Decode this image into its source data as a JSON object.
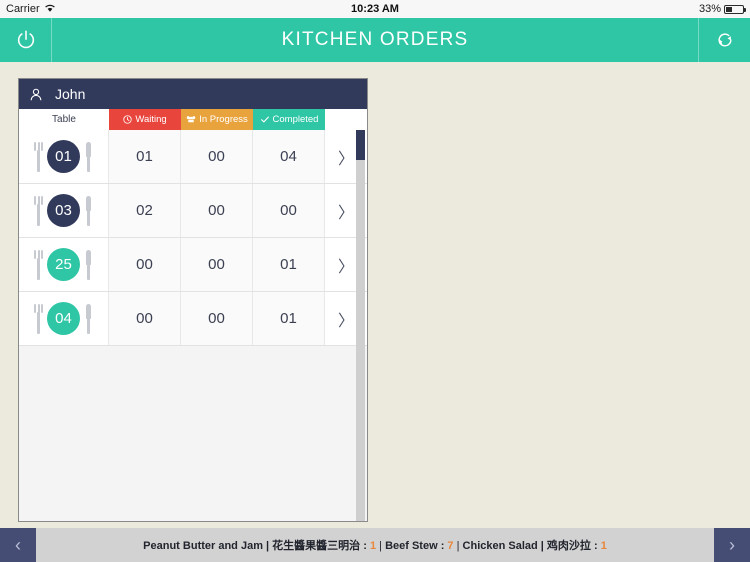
{
  "status_bar": {
    "carrier": "Carrier",
    "wifi_icon": "wifi-icon",
    "time": "10:23 AM",
    "battery_percent": "33%",
    "battery_level": 33
  },
  "app_header": {
    "title": "KITCHEN ORDERS",
    "power_icon": "power-icon",
    "refresh_icon": "refresh-icon",
    "background_color": "#2ec6a5"
  },
  "orders_panel": {
    "waiter_icon": "user-icon",
    "waiter_name": "John",
    "header_color": "#323a5c",
    "columns": [
      {
        "key": "table",
        "label": "Table",
        "icon": "",
        "color": "#ffffff"
      },
      {
        "key": "waiting",
        "label": "Waiting",
        "icon": "clock-icon",
        "color": "#e8453c"
      },
      {
        "key": "progress",
        "label": "In Progress",
        "icon": "chef-hat-icon",
        "color": "#e8a33d"
      },
      {
        "key": "completed",
        "label": "Completed",
        "icon": "check-icon",
        "color": "#2ec6a5"
      }
    ],
    "rows": [
      {
        "table": "01",
        "badge_color": "#323a5c",
        "waiting": "01",
        "progress": "00",
        "completed": "04",
        "chevron": "〉"
      },
      {
        "table": "03",
        "badge_color": "#323a5c",
        "waiting": "02",
        "progress": "00",
        "completed": "00",
        "chevron": "〉"
      },
      {
        "table": "25",
        "badge_color": "#2ec6a5",
        "waiting": "00",
        "progress": "00",
        "completed": "01",
        "chevron": "〉"
      },
      {
        "table": "04",
        "badge_color": "#2ec6a5",
        "waiting": "00",
        "progress": "00",
        "completed": "01",
        "chevron": "〉"
      }
    ],
    "scrollbar": {
      "name": "vertical-scrollbar",
      "thumb_color": "#323a5c"
    }
  },
  "ticker": {
    "prev_label": "‹",
    "next_label": "›",
    "items": [
      {
        "name": "Peanut Butter and Jam | 花生醬果醬三明治",
        "qty": "1"
      },
      {
        "name": "Beef Stew",
        "qty": "7"
      },
      {
        "name": "Chicken Salad  | 鸡肉沙拉",
        "qty": "1"
      }
    ],
    "separator": "|",
    "colon": ":",
    "qty_color": "#e8873d"
  }
}
